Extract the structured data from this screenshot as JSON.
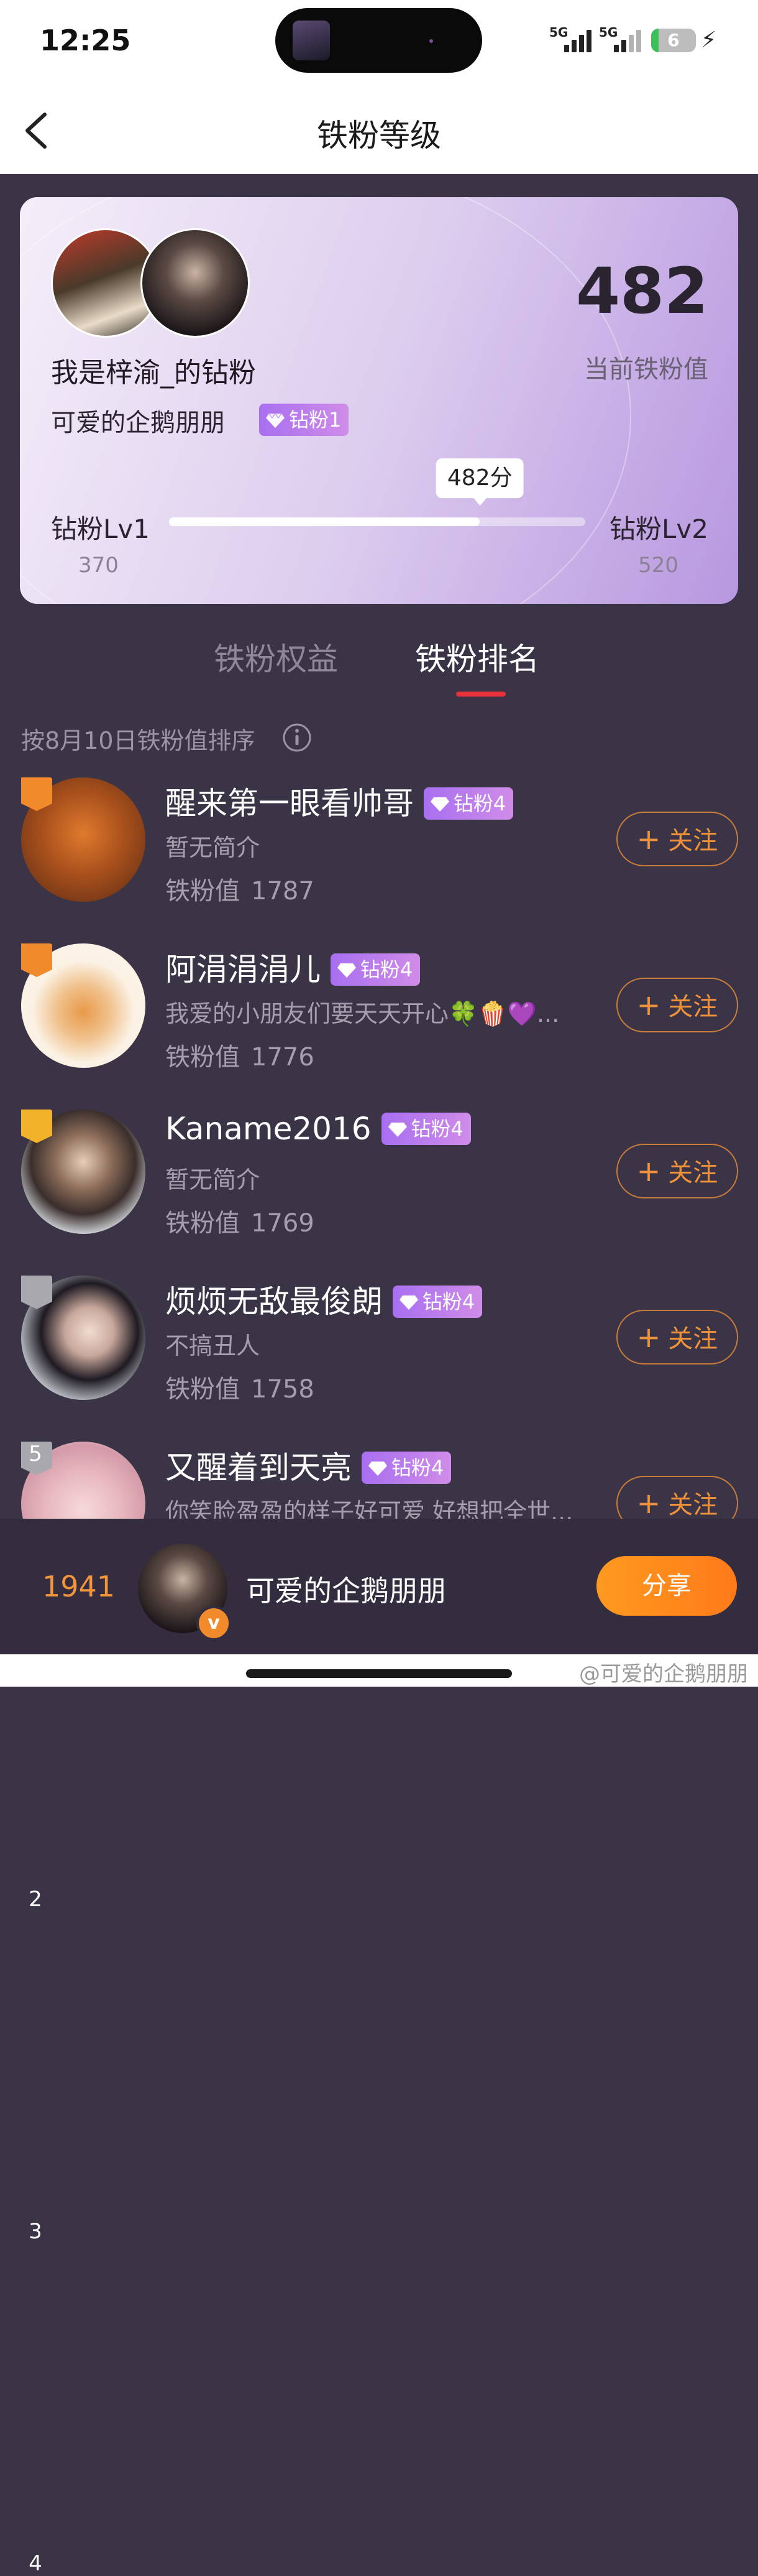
{
  "status_bar": {
    "time": "12:25",
    "net1": "5G",
    "net2": "5G",
    "battery": "6"
  },
  "header": {
    "title": "铁粉等级"
  },
  "fan_card": {
    "group_name": "我是梓渝_的钻粉",
    "username": "可爱的企鹅朋朋",
    "badge": "钻粉1",
    "score": "482",
    "score_label": "当前铁粉值",
    "progress_tooltip": "482分",
    "progress_value": 482,
    "progress_min": 370,
    "progress_max": 520,
    "level_left": "钻粉Lv1",
    "level_left_value": "370",
    "level_right": "钻粉Lv2",
    "level_right_value": "520"
  },
  "tabs": [
    {
      "label": "铁粉权益",
      "active": false
    },
    {
      "label": "铁粉排名",
      "active": true
    }
  ],
  "sort_note": "按8月10日铁粉值排序",
  "score_label": "铁粉值",
  "follow_label": "关注",
  "ranking": [
    {
      "rank": "1",
      "name": "醒来第一眼看帅哥",
      "badge": "钻粉4",
      "bio": "暂无简介",
      "score": "1787"
    },
    {
      "rank": "2",
      "name": "阿涓涓涓儿",
      "badge": "钻粉4",
      "bio": "我爱的小朋友们要天天开心🍀🍿💜...",
      "score": "1776"
    },
    {
      "rank": "3",
      "name": "Kaname2016",
      "badge": "钻粉4",
      "bio": "暂无简介",
      "score": "1769"
    },
    {
      "rank": "4",
      "name": "烦烦无敌最俊朗",
      "badge": "钻粉4",
      "bio": "不搞丑人",
      "score": "1758"
    },
    {
      "rank": "5",
      "name": "又醒着到天亮",
      "badge": "钻粉4",
      "bio": "你笑脸盈盈的样子好可爱 好想把全世...",
      "score": ""
    }
  ],
  "bottom_bar": {
    "my_rank": "1941",
    "my_name": "可爱的企鹅朋朋",
    "share_label": "分享"
  },
  "watermark": "@可爱的企鹅朋朋",
  "colors": {
    "accent": "#f5953a",
    "badge_purple": "#b27cec",
    "tab_underline": "#e8313b",
    "background": "#3a3446"
  }
}
